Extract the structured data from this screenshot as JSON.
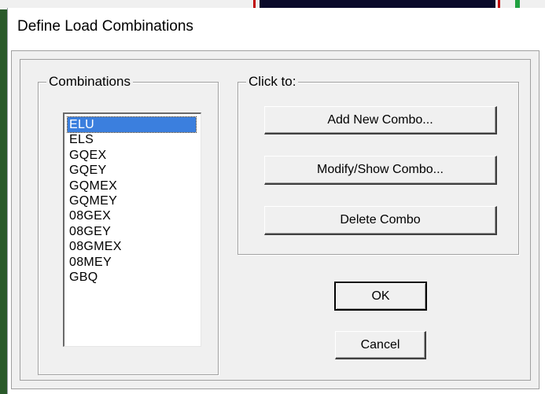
{
  "window": {
    "title": "Define Load Combinations"
  },
  "combinations_group": {
    "label": "Combinations",
    "items": [
      "ELU",
      "ELS",
      "GQEX",
      "GQEY",
      "GQMEX",
      "GQMEY",
      "08GEX",
      "08GEY",
      "08GMEX",
      "08MEY",
      "GBQ"
    ],
    "selected": "ELU"
  },
  "click_to_group": {
    "label": "Click to:",
    "add_button": "Add New Combo...",
    "modify_button": "Modify/Show Combo...",
    "delete_button": "Delete Combo"
  },
  "footer": {
    "ok_button": "OK",
    "cancel_button": "Cancel"
  },
  "colors": {
    "selection": "#3b7fde",
    "face": "#f0f0f0"
  }
}
